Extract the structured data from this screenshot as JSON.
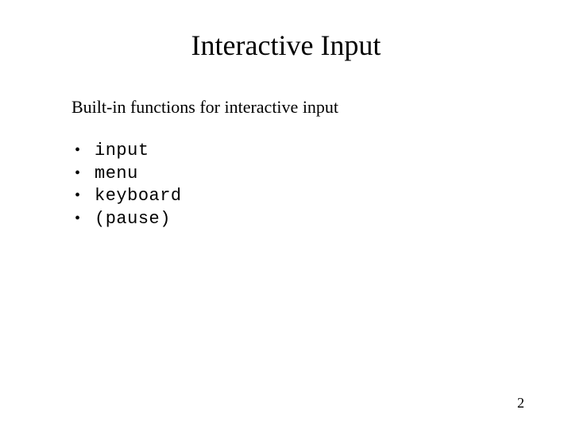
{
  "title": "Interactive Input",
  "subtitle": "Built-in functions for interactive input",
  "bullets": {
    "b0": "input",
    "b1": "menu",
    "b2": "keyboard",
    "b3": "(pause)"
  },
  "page_number": "2"
}
